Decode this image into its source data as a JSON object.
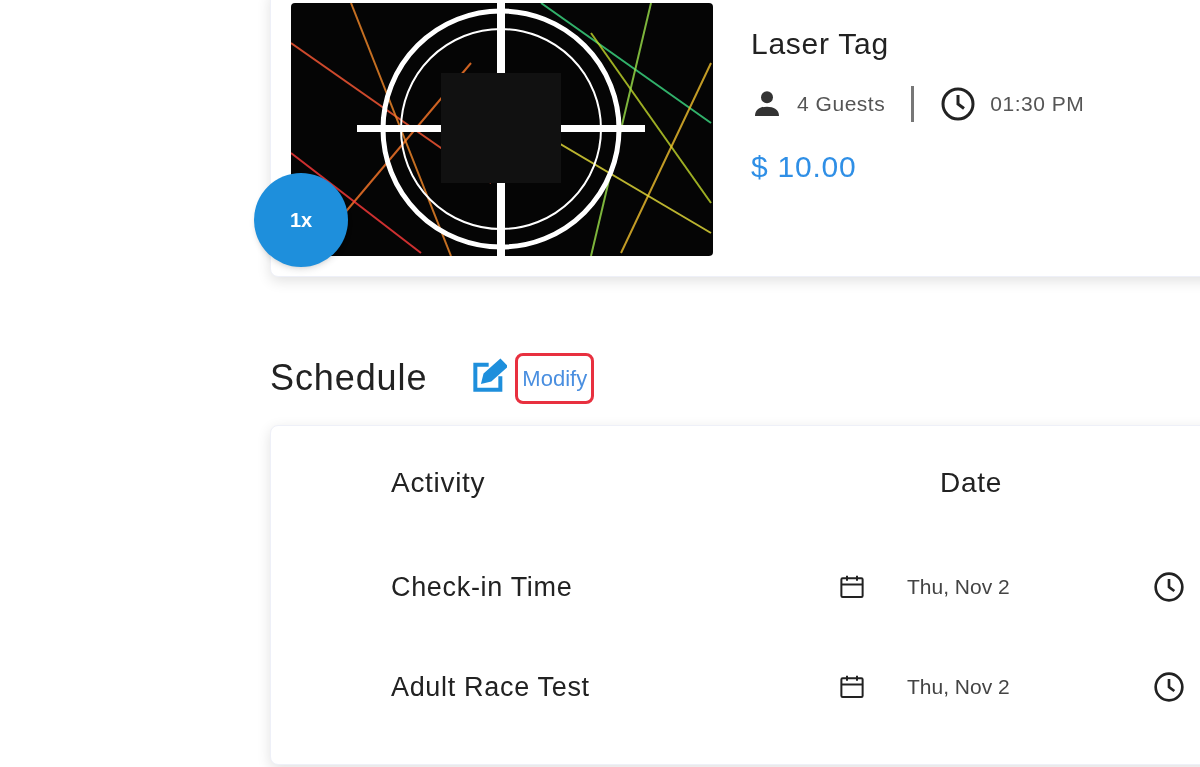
{
  "item": {
    "kind": "picture",
    "title": "Laser Tag",
    "quantity": "1x",
    "guests": "4 Guests",
    "time": "01:30 PM",
    "price": "$ 10.00"
  },
  "schedule": {
    "title": "Schedule",
    "modify_link": {
      "label": "Modify",
      "highlighted": true
    },
    "columns": [
      "Activity",
      "Date"
    ],
    "rows": [
      {
        "activity": "Check-in Time",
        "date": "Thu, Nov 2"
      },
      {
        "activity": "Adult Race Test",
        "date": "Thu, Nov 2"
      }
    ]
  }
}
